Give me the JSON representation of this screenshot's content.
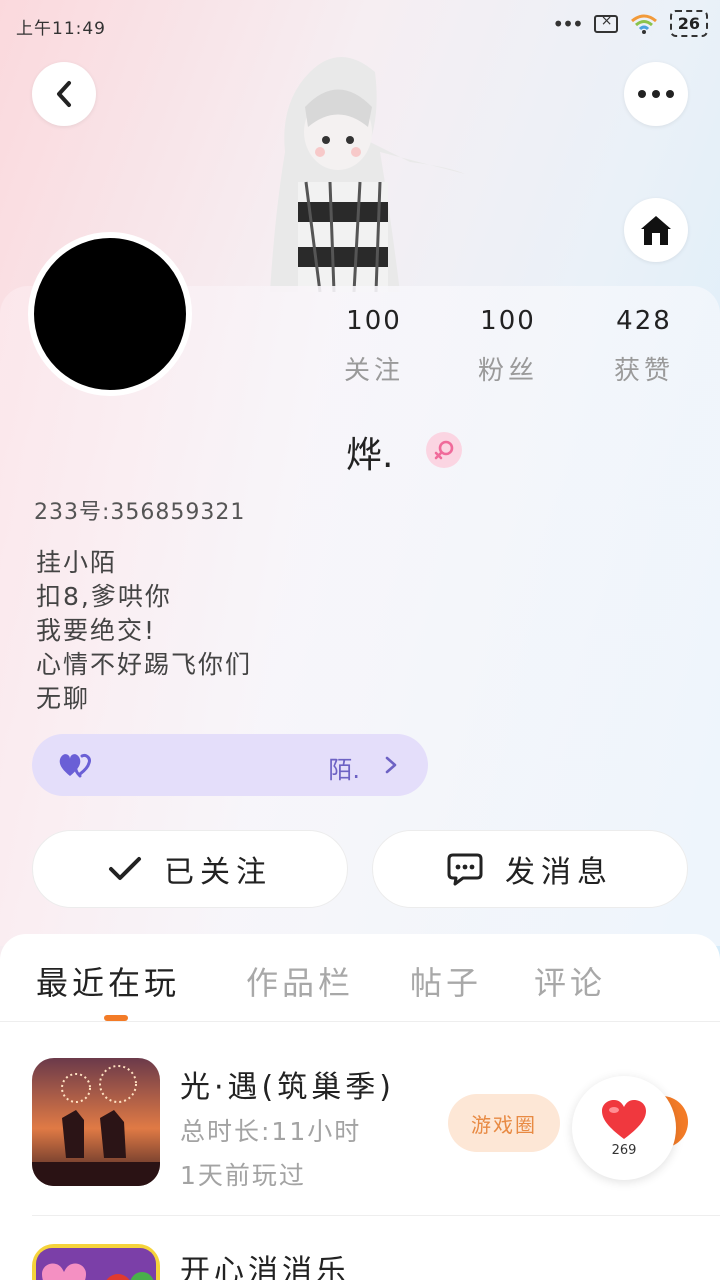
{
  "status_bar": {
    "time": "上午11:49",
    "battery": "26"
  },
  "profile": {
    "stats": [
      {
        "value": "100",
        "label": "关注"
      },
      {
        "value": "100",
        "label": "粉丝"
      },
      {
        "value": "428",
        "label": "获赞"
      }
    ],
    "nickname": "烨.",
    "gender": "female",
    "id_line": "233号:356859321",
    "bio": [
      "挂小陌",
      "扣8,爹哄你",
      "我要绝交!",
      "心情不好踢飞你们",
      "无聊"
    ],
    "relation": {
      "name": "陌."
    }
  },
  "actions": {
    "follow_label": "已关注",
    "message_label": "发消息"
  },
  "tabs": [
    {
      "label": "最近在玩"
    },
    {
      "label": "作品栏"
    },
    {
      "label": "帖子"
    },
    {
      "label": "评论"
    }
  ],
  "games": [
    {
      "title": "光·遇(筑巢季)",
      "duration": "总时长:11小时",
      "last_played": "1天前玩过",
      "circle_label": "游戏圈"
    },
    {
      "title": "开心消消乐"
    }
  ],
  "like_float": {
    "count": "269"
  },
  "colors": {
    "accent": "#f37b27",
    "relation_bg": "#e4defa",
    "relation_text": "#6d62c4",
    "female_pink": "#f06a9a"
  }
}
